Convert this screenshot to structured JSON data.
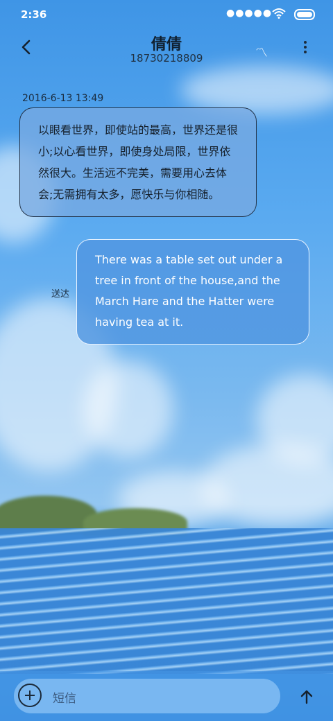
{
  "status_bar": {
    "time": "2:36",
    "signal": "●●●●●",
    "wifi_icon": "wifi-icon",
    "battery_icon": "battery-icon"
  },
  "header": {
    "title": "倩倩",
    "phone": "18730218809",
    "back_icon": "back-arrow-icon",
    "more_icon": "more-vertical-icon"
  },
  "conversation": {
    "timestamp": "2016-6-13 13:49",
    "messages": [
      {
        "direction": "incoming",
        "text": "以眼看世界，即使站的最高，世界还是很小;以心看世界，即使身处局限，世界依然很大。生活远不完美，需要用心去体会;无需拥有太多，愿快乐与你相随。"
      },
      {
        "direction": "outgoing",
        "text": "There was a table set out under a tree in front of the house,and the March Hare and the Hatter were having tea at it.",
        "status": "送达"
      }
    ]
  },
  "composer": {
    "placeholder": "短信",
    "add_icon": "plus-circle-icon",
    "send_icon": "send-arrow-icon"
  },
  "colors": {
    "sky": "#4d9fe8",
    "outgoing_bubble": "#5096e1",
    "incoming_bubble": "#78aae1",
    "text_dark": "#15202c"
  }
}
